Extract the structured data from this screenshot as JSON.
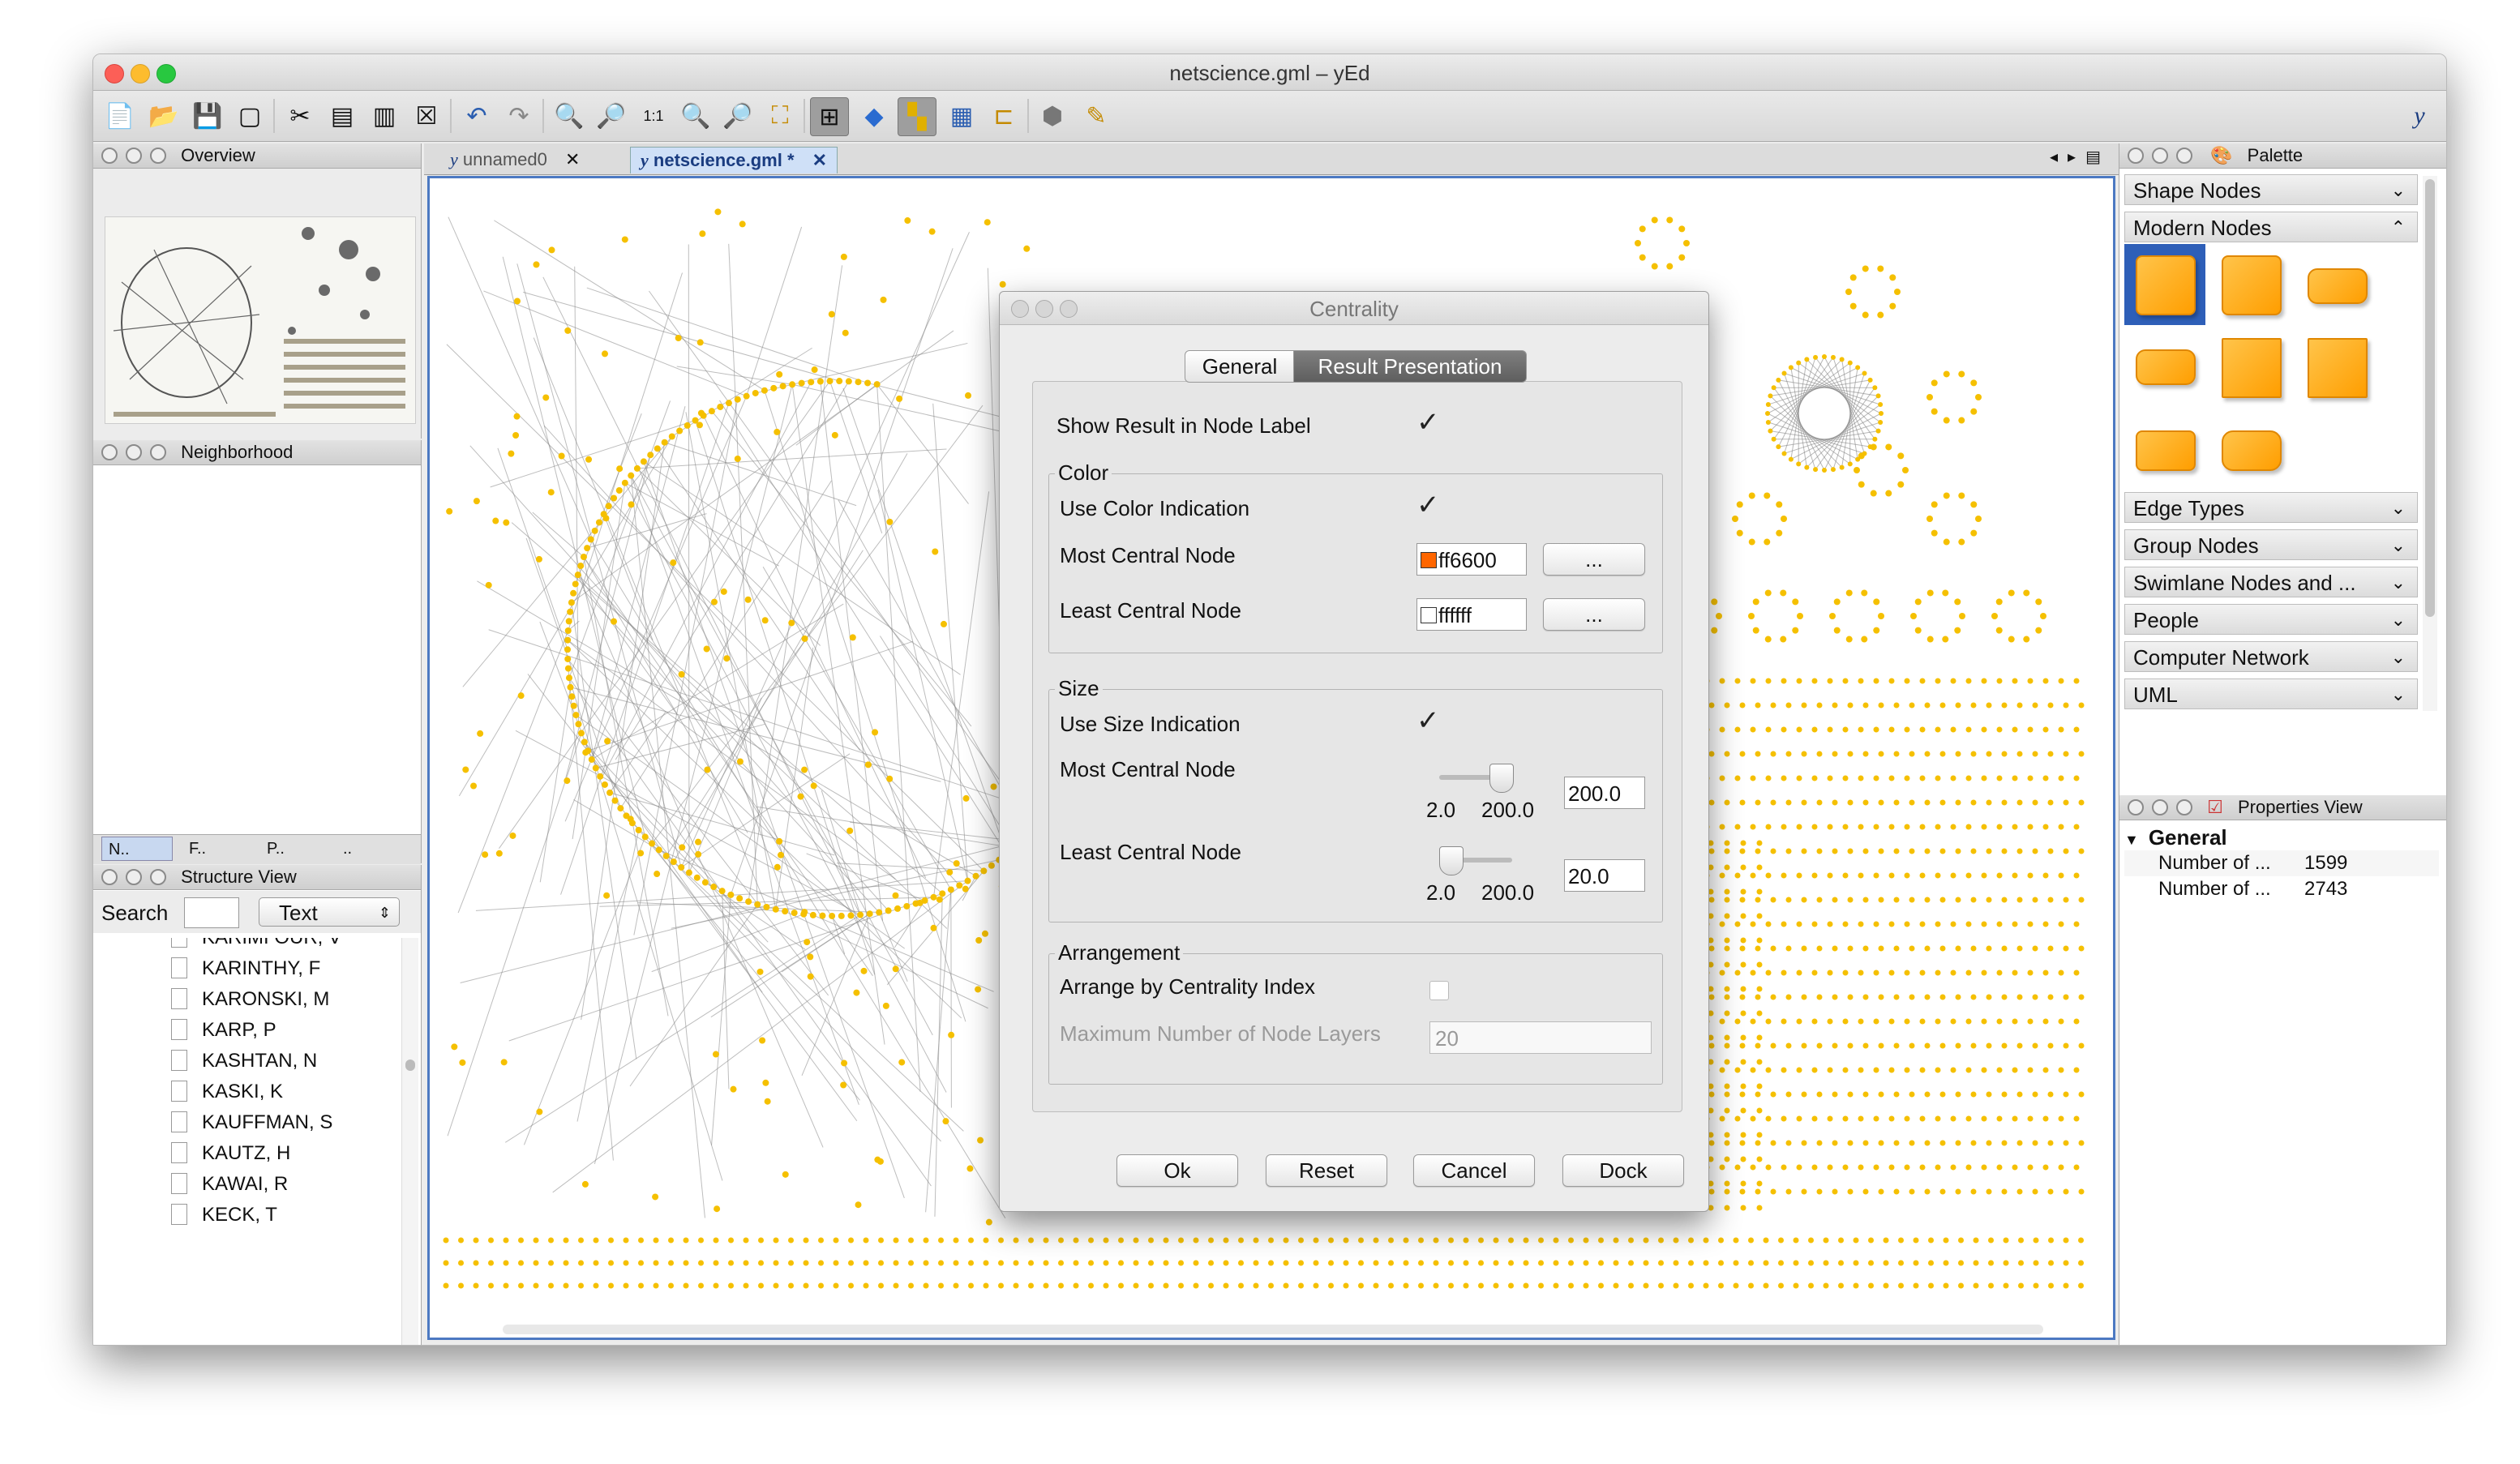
{
  "window": {
    "title": "netscience.gml – yEd"
  },
  "toolbar": {
    "icons": [
      "new-document-icon",
      "open-folder-icon",
      "save-icon",
      "save-as-icon",
      "cut-icon",
      "copy-icon",
      "paste-icon",
      "delete-icon",
      "undo-icon",
      "redo-icon",
      "zoom-in-icon",
      "zoom-out-icon",
      "zoom-original-icon",
      "zoom-fit-icon",
      "zoom-area-icon",
      "fit-content-icon",
      "navigation-mode-icon",
      "snap-icon",
      "grid-orthogonal-icon",
      "grid-icon",
      "balloon-icon",
      "group-icon",
      "magic-wand-icon",
      "yed-logo-icon"
    ]
  },
  "overview": {
    "title": "Overview"
  },
  "neighborhood": {
    "title": "Neighborhood",
    "tabs": [
      "N..",
      "F..",
      "P..",
      ".."
    ]
  },
  "structure": {
    "title": "Structure View",
    "search_label": "Search",
    "search_value": "",
    "type_select": "Text",
    "items": [
      "KARIMI OUR, V",
      "KARINTHY, F",
      "KARONSKI, M",
      "KARP, P",
      "KASHTAN, N",
      "KASKI, K",
      "KAUFFMAN, S",
      "KAUTZ, H",
      "KAWAI, R",
      "KECK, T"
    ]
  },
  "doc_tabs": [
    {
      "label": "unnamed0",
      "close": "✕"
    },
    {
      "label": "netscience.gml *",
      "close": "✕"
    }
  ],
  "palette": {
    "title": "Palette",
    "sections": [
      {
        "label": "Shape Nodes",
        "chevron": "⌄"
      },
      {
        "label": "Modern Nodes",
        "chevron": "⌃"
      },
      {
        "label": "Edge Types",
        "chevron": "⌄"
      },
      {
        "label": "Group Nodes",
        "chevron": "⌄"
      },
      {
        "label": "Swimlane Nodes and ...",
        "chevron": "⌄"
      },
      {
        "label": "People",
        "chevron": "⌄"
      },
      {
        "label": "Computer Network",
        "chevron": "⌄"
      },
      {
        "label": "UML",
        "chevron": "⌄"
      }
    ]
  },
  "properties": {
    "title": "Properties View",
    "group": "General",
    "rows": [
      {
        "key": "Number of ...",
        "value": "1599"
      },
      {
        "key": "Number of ...",
        "value": "2743"
      }
    ]
  },
  "dialog": {
    "title": "Centrality",
    "tabs": [
      "General",
      "Result Presentation"
    ],
    "show_result_label": "Show Result in Node Label",
    "show_result_checked": "✓",
    "color": {
      "group": "Color",
      "use_label": "Use Color Indication",
      "use_checked": "✓",
      "most_label": "Most Central Node",
      "most_value": "ff6600",
      "most_color": "#ff6600",
      "least_label": "Least Central Node",
      "least_value": "ffffff",
      "least_color": "#ffffff",
      "browse": "..."
    },
    "size": {
      "group": "Size",
      "use_label": "Use Size Indication",
      "use_checked": "✓",
      "most_label": "Most Central Node",
      "most_value": "200.0",
      "most_level": 1.0,
      "least_label": "Least Central Node",
      "least_value": "20.0",
      "least_level": 0.0,
      "min": "2.0",
      "max": "200.0"
    },
    "arrangement": {
      "group": "Arrangement",
      "arrange_label": "Arrange by Centrality Index",
      "layers_label": "Maximum Number of Node Layers",
      "layers_value": "20"
    },
    "buttons": {
      "ok": "Ok",
      "reset": "Reset",
      "cancel": "Cancel",
      "dock": "Dock"
    }
  },
  "colors": {
    "accent": "#4c79c2",
    "node": "#f5c000",
    "edge": "#888888"
  }
}
